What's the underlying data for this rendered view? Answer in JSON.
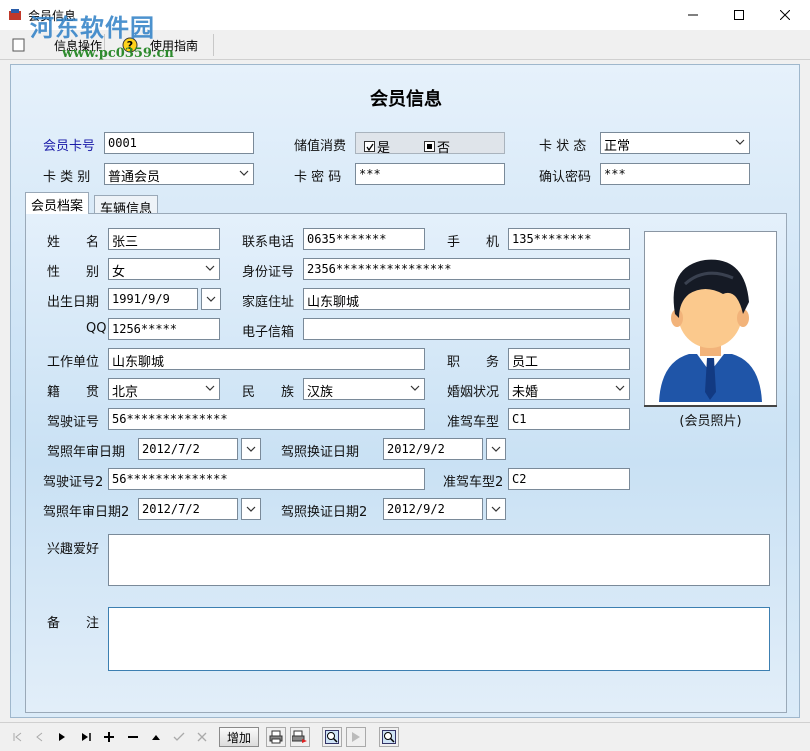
{
  "window": {
    "title": "会员信息"
  },
  "watermark": {
    "site": "河东软件园",
    "url": "www.pc0359.cn"
  },
  "toolbar": {
    "info_ops": "信息操作",
    "help": "使用指南"
  },
  "form": {
    "title": "会员信息",
    "card_no_label": "会员卡号",
    "card_no": "0001",
    "stored_value_label": "储值消费",
    "stored_yes": "是",
    "stored_no": "否",
    "card_status_label": "卡 状 态",
    "card_status": "正常",
    "card_type_label": "卡 类 别",
    "card_type": "普通会员",
    "card_pwd_label": "卡 密 码",
    "card_pwd": "***",
    "confirm_pwd_label": "确认密码",
    "confirm_pwd": "***"
  },
  "tabs": [
    "会员档案",
    "车辆信息"
  ],
  "profile": {
    "name_label": "姓　　名",
    "name": "张三",
    "contact_label": "联系电话",
    "contact": "0635*******",
    "mobile_label": "手　　机",
    "mobile": "135********",
    "gender_label": "性　　别",
    "gender": "女",
    "id_label": "身份证号",
    "id": "2356****************",
    "birth_label": "出生日期",
    "birth": "1991/9/9",
    "address_label": "家庭住址",
    "address": "山东聊城",
    "qq_label": "QQ",
    "qq": "1256*****",
    "email_label": "电子信箱",
    "email": "",
    "work_label": "工作单位",
    "work": "山东聊城",
    "job_label": "职　　务",
    "job": "员工",
    "native_label": "籍　　贯",
    "native": "北京",
    "ethnic_label": "民　　族",
    "ethnic": "汉族",
    "marital_label": "婚姻状况",
    "marital": "未婚",
    "license_label": "驾驶证号",
    "license": "56**************",
    "class_label": "准驾车型",
    "class": "C1",
    "review_label": "驾照年审日期",
    "review": "2012/7/2",
    "renew_label": "驾照换证日期",
    "renew": "2012/9/2",
    "license2_label": "驾驶证号2",
    "license2": "56**************",
    "class2_label": "准驾车型2",
    "class2": "C2",
    "review2_label": "驾照年审日期2",
    "review2": "2012/7/2",
    "renew2_label": "驾照换证日期2",
    "renew2": "2012/9/2",
    "hobby_label": "兴趣爱好",
    "hobby": "",
    "remark_label": "备　　注",
    "remark": "",
    "photo_caption": "(会员照片)"
  },
  "navigator": {
    "add_label": "增加"
  },
  "colors": {
    "accent": "#1a1aa8",
    "panel_top": "#e6f1fb",
    "panel_mid": "#c7e0f4"
  }
}
